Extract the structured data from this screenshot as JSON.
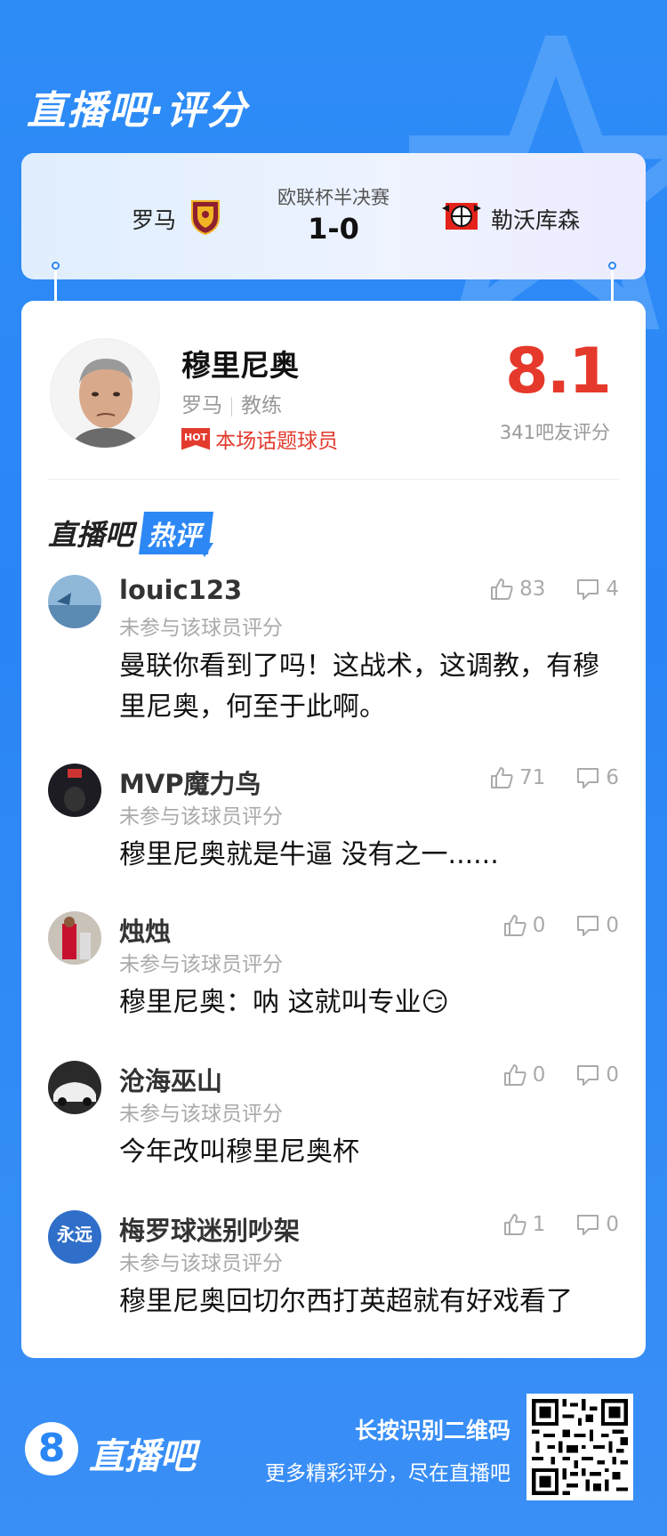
{
  "header": {
    "title": "直播吧·评分"
  },
  "match": {
    "home_team": "罗马",
    "away_team": "勒沃库森",
    "stage": "欧联杯半决赛",
    "score": "1-0"
  },
  "player": {
    "name": "穆里尼奥",
    "team": "罗马",
    "role": "教练",
    "hot_badge": "HOT",
    "hot_label": "本场话题球员",
    "rating": "8.1",
    "rating_count": "341吧友评分"
  },
  "section": {
    "brand": "直播吧",
    "tag": "热评"
  },
  "comments": [
    {
      "user": "louic123",
      "sub": "未参与该球员评分",
      "text": "曼联你看到了吗！这战术，这调教，有穆里尼奥，何至于此啊。",
      "likes": "83",
      "replies": "4"
    },
    {
      "user": "MVP魔力鸟",
      "sub": "未参与该球员评分",
      "text": "穆里尼奥就是牛逼 没有之一......",
      "likes": "71",
      "replies": "6"
    },
    {
      "user": "烛烛",
      "sub": "未参与该球员评分",
      "text": "穆里尼奥：呐 这就叫专业😏",
      "likes": "0",
      "replies": "0"
    },
    {
      "user": "沧海巫山",
      "sub": "未参与该球员评分",
      "text": "今年改叫穆里尼奥杯",
      "likes": "0",
      "replies": "0"
    },
    {
      "user": "梅罗球迷别吵架",
      "sub": "未参与该球员评分",
      "text": "穆里尼奥回切尔西打英超就有好戏看了",
      "likes": "1",
      "replies": "0"
    }
  ],
  "footer": {
    "logo_glyph": "8",
    "brand": "直播吧",
    "qr_title": "长按识别二维码",
    "qr_sub": "更多精彩评分，尽在直播吧"
  },
  "colors": {
    "brand_blue": "#2a86f5",
    "rating_red": "#e5392b"
  }
}
